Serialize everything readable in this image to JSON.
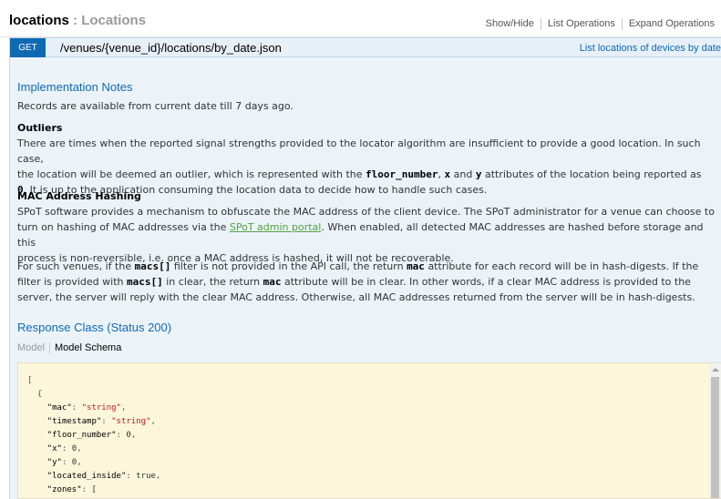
{
  "header": {
    "resource": "locations",
    "separator": ":",
    "resource_label": "Locations",
    "ops": [
      "Show/Hide",
      "List Operations",
      "Expand Operations"
    ]
  },
  "endpoint": {
    "method": "GET",
    "path": "/venues/{venue_id}/locations/by_date.json",
    "summary": "List locations of devices by date"
  },
  "notes": {
    "heading": "Implementation Notes",
    "intro": "Records are available from current date till 7 days ago.",
    "outliers_title": "Outliers",
    "outliers_p1": "There are times when the reported signal strengths provided to the locator algorithm are insufficient to provide a good location. In such case,",
    "outliers_p2a": "the location will be deemed an outlier, which is represented with the",
    "code_floor": "floor_number",
    "comma": ",",
    "code_x": "x",
    "and": "and",
    "code_y": "y",
    "outliers_p2b": "attributes of the location being reported as",
    "code_zero": "0",
    "outliers_p3": ". It is up to the application consuming the location data to decide how to handle such cases.",
    "mac_title": "MAC Address Hashing",
    "mac_p1": "SPoT software provides a mechanism to obfuscate the MAC address of the client device. The SPoT administrator for a venue can choose to",
    "mac_p2a": "turn on hashing of MAC addresses via the",
    "mac_link": "SPoT admin portal",
    "mac_p2b": ". When enabled, all detected MAC addresses are hashed before storage and this",
    "mac_p3": "process is non-reversible, i.e. once a MAC address is hashed, it will not be recoverable.",
    "venue_p1a": "For such venues, if the",
    "code_macs": "macs[]",
    "venue_p1b": "filter is not provided in the API call, the return",
    "code_mac": "mac",
    "venue_p1c": "attribute for each record will be in hash-digests. If the",
    "venue_p2a": "filter is provided with",
    "venue_p2b": "in clear, the return",
    "venue_p2c": "attribute will be in clear. In other words, if a clear MAC address is provided to the",
    "venue_p3": "server, the server will reply with the clear MAC address. Otherwise, all MAC addresses returned from the server will be in hash-digests."
  },
  "response": {
    "heading": "Response Class (Status 200)",
    "tab_model": "Model",
    "tab_schema": "Model Schema"
  },
  "schema": {
    "open_array": "[",
    "open_obj": "{",
    "fields": [
      {
        "key": "\"mac\"",
        "value": "\"string\"",
        "type": "s"
      },
      {
        "key": "\"timestamp\"",
        "value": "\"string\"",
        "type": "s"
      },
      {
        "key": "\"floor_number\"",
        "value": "0",
        "type": "n"
      },
      {
        "key": "\"x\"",
        "value": "0",
        "type": "n"
      },
      {
        "key": "\"y\"",
        "value": "0",
        "type": "n"
      },
      {
        "key": "\"located_inside\"",
        "value": "true",
        "type": "n"
      },
      {
        "key": "\"zones\"",
        "value": "[",
        "type": "n"
      }
    ]
  }
}
